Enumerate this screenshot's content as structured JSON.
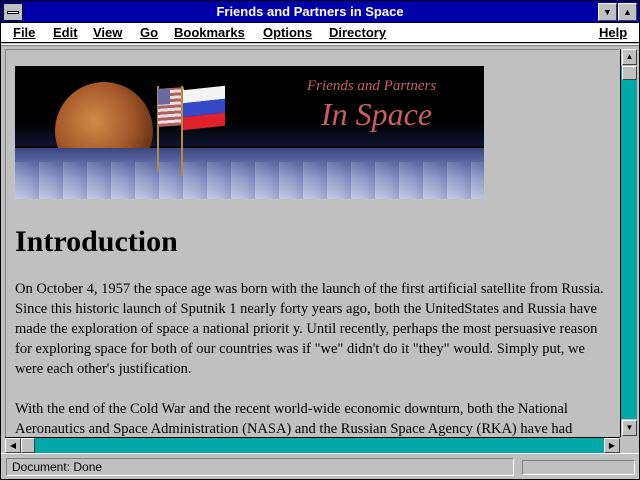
{
  "window": {
    "title": "Friends and Partners in Space"
  },
  "menu": {
    "items": [
      {
        "label": "File"
      },
      {
        "label": "Edit"
      },
      {
        "label": "View"
      },
      {
        "label": "Go"
      },
      {
        "label": "Bookmarks"
      },
      {
        "label": "Options"
      },
      {
        "label": "Directory"
      },
      {
        "label": "Help"
      }
    ]
  },
  "banner": {
    "line1": "Friends and Partners",
    "line2": "In Space"
  },
  "page": {
    "heading": "Introduction",
    "paragraphs": [
      "On October 4, 1957 the space age was born with the launch of the first artificial satellite from Russia. Since this historic launch of Sputnik 1 nearly forty years ago, both the UnitedStates and Russia have made the exploration of space a national priorit y. Until recently, perhaps the most persuasive reason for exploring space for both of our countries was if \"we\" didn't do it \"they\" would. Simply put, we were each other's justification.",
      "With the end of the Cold War and the recent world-wide economic downturn, both the National Aeronautics and Space Administration (NASA) and the Russian Space Agency (RKA) have had"
    ]
  },
  "status": {
    "text": "Document: Done"
  },
  "colors": {
    "title_bar": "#0000aa",
    "scroll_track": "#00a8a8",
    "banner_text": "#c86060"
  }
}
